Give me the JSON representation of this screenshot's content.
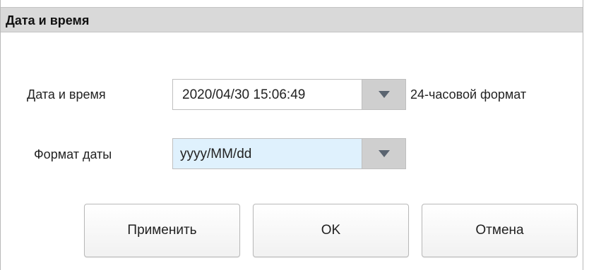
{
  "dialog": {
    "title": "Дата и время"
  },
  "datetime_row": {
    "label": "Дата и время",
    "value": "2020/04/30 15:06:49",
    "note": "24-часовой формат",
    "dropdown_icon": "chevron-down-icon"
  },
  "format_row": {
    "label": "Формат даты",
    "value": "yyyy/MM/dd",
    "dropdown_icon": "chevron-down-icon"
  },
  "buttons": {
    "apply": "Применить",
    "ok": "OK",
    "cancel": "Отмена"
  },
  "colors": {
    "title_bar": "#d9d9d9",
    "selected_field": "#dff1fd",
    "dropdown_button": "#cfcfcf"
  }
}
